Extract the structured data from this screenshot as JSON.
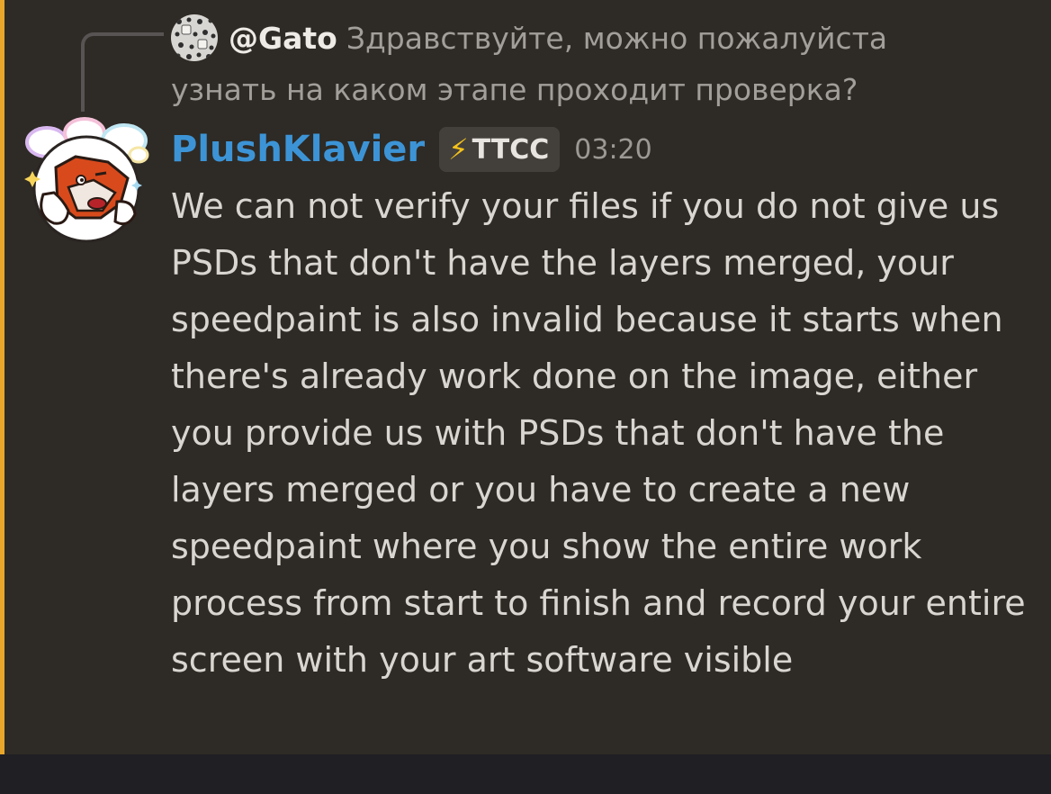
{
  "reply": {
    "author": "@Gato",
    "text": "Здравствуйте, можно пожалуйста узнать на каком этапе проходит проверка?"
  },
  "message": {
    "username": "PlushKlavier",
    "tag": {
      "icon": "⚡",
      "label": "TTCC"
    },
    "timestamp": "03:20",
    "content": "We can not verify your files if you do not give us PSDs that don't have the layers merged, your speedpaint is also invalid because it starts when there's already work done on the image, either you provide us with PSDs that don't have the layers merged or you have to create a new speedpaint where you show the entire work process from start to finish and record your entire screen with your art software visible"
  },
  "colors": {
    "background": "#2e2a25",
    "mention_bar": "#e8a62b",
    "username": "#3c94d6",
    "message_text": "#d9d5d0",
    "reply_text": "#a29f9b",
    "tag_icon": "#f5c21b"
  }
}
